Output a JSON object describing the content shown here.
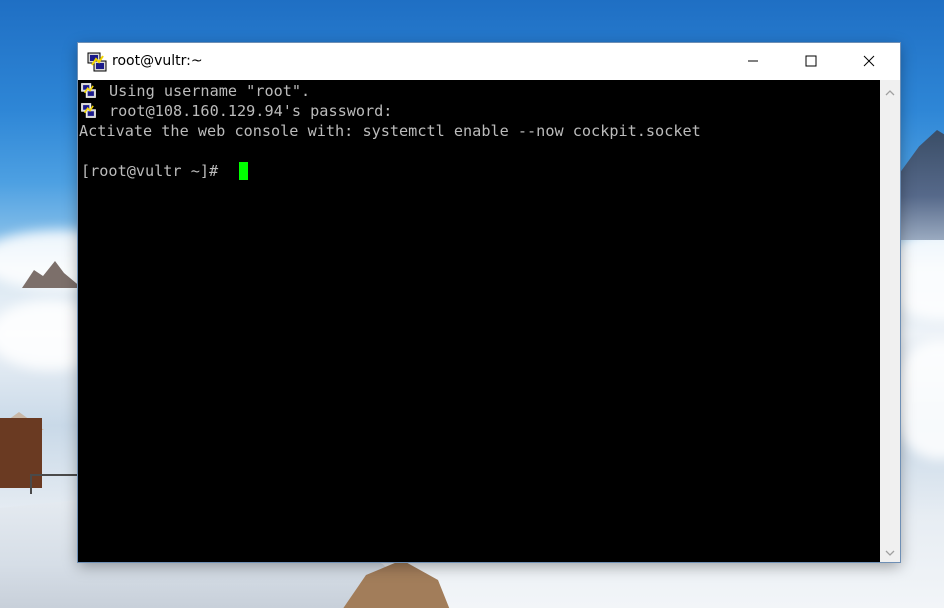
{
  "window": {
    "title": "root@vultr:~"
  },
  "terminal": {
    "lines": [
      "Using username \"root\".",
      "root@108.160.129.94's password:",
      "Activate the web console with: systemctl enable --now cockpit.socket",
      "",
      "[root@vultr ~]# "
    ],
    "cursor_color": "#00ff00",
    "text_color": "#bbbbbb",
    "background": "#000000"
  },
  "icons": {
    "app": "putty-icon",
    "minimize": "minimize-icon",
    "maximize": "maximize-icon",
    "close": "close-icon",
    "scroll_up": "scroll-up-arrow-icon",
    "scroll_down": "scroll-down-arrow-icon"
  }
}
